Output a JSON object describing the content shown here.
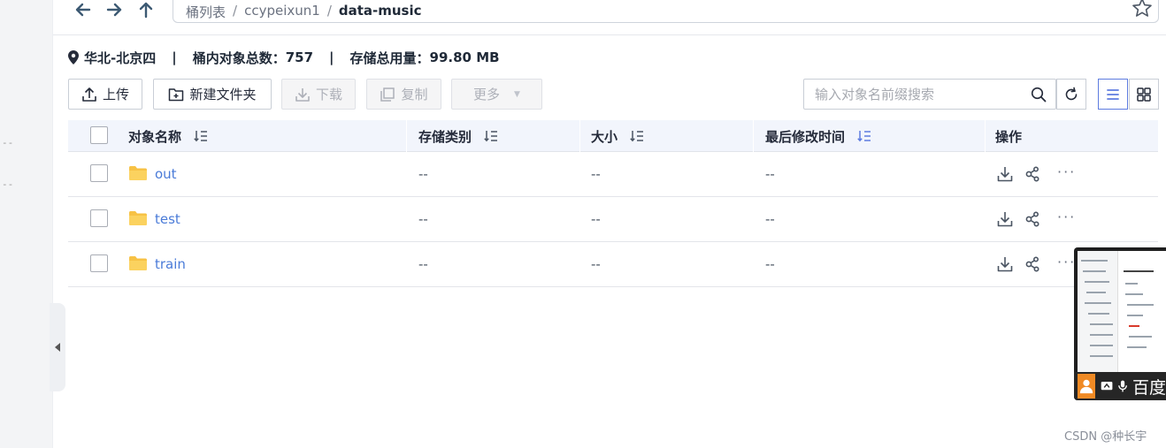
{
  "nav": {
    "back_icon": "arrow-left-icon",
    "forward_icon": "arrow-right-icon",
    "up_icon": "arrow-up-icon"
  },
  "breadcrumb": {
    "root": "桶列表",
    "bucket": "ccypeixun1",
    "current": "data-music",
    "separator": "/"
  },
  "info": {
    "region": "华北-北京四",
    "object_count_label": "桶内对象总数：",
    "object_count": "757",
    "storage_label": "存储总用量：",
    "storage_value": "99.80 MB",
    "divider": "|"
  },
  "toolbar": {
    "upload": "上传",
    "new_folder": "新建文件夹",
    "download": "下载",
    "copy": "复制",
    "more": "更多"
  },
  "search": {
    "placeholder": "输入对象名前缀搜索"
  },
  "table": {
    "headers": {
      "name": "对象名称",
      "storage_class": "存储类别",
      "size": "大小",
      "modified": "最后修改时间",
      "actions": "操作"
    },
    "rows": [
      {
        "name": "out",
        "storage_class": "--",
        "size": "--",
        "modified": "--"
      },
      {
        "name": "test",
        "storage_class": "--",
        "size": "--",
        "modified": "--"
      },
      {
        "name": "train",
        "storage_class": "--",
        "size": "--",
        "modified": "--"
      }
    ],
    "more_actions": "···"
  },
  "left_strip": {
    "dash1": "--",
    "dash2": "--"
  },
  "thumbnail": {
    "label": "百度"
  },
  "watermark": "CSDN @种长宇",
  "colors": {
    "accent": "#5e7ce0",
    "link": "#4a7bd8",
    "folder": "#f7c245",
    "header_bg": "#f2f5fc"
  }
}
